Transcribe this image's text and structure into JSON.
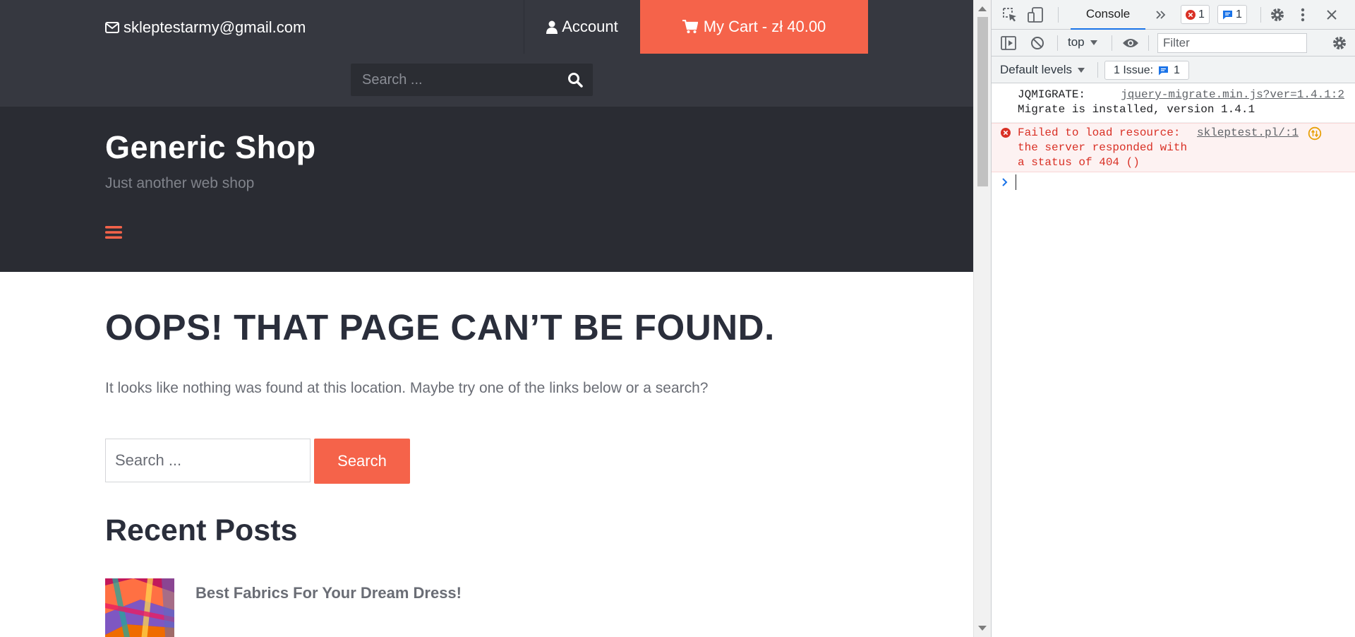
{
  "topbar": {
    "email": "skleptestarmy@gmail.com",
    "account_label": "Account",
    "cart_label": "My Cart - zł 40.00",
    "search_placeholder": "Search ..."
  },
  "header": {
    "site_title": "Generic Shop",
    "tagline": "Just another web shop"
  },
  "content": {
    "page_title": "OOPS! THAT PAGE CAN’T BE FOUND.",
    "description": "It looks like nothing was found at this location. Maybe try one of the links below or a search?",
    "search_placeholder": "Search ...",
    "search_button": "Search",
    "recent_posts_title": "Recent Posts",
    "recent_posts": [
      {
        "title": "Best Fabrics For Your Dream Dress!"
      }
    ]
  },
  "colors": {
    "accent": "#f5634a",
    "topbar_bg": "#363840",
    "header_bg": "#2a2c33",
    "devtools_blue": "#1a73e8",
    "error_red": "#d93025"
  },
  "devtools": {
    "tabs": {
      "console": "Console"
    },
    "error_count": "1",
    "message_count": "1",
    "context": "top",
    "filter_placeholder": "Filter",
    "default_levels": "Default levels",
    "issues_label": "1 Issue:",
    "issues_count": "1",
    "logs": {
      "info_prefix": "JQMIGRATE:",
      "info_source": "jquery-migrate.min.js?ver=1.4.1:2",
      "info_message": "Migrate is installed, version 1.4.1",
      "error_line1": "Failed to load resource:",
      "error_line2": "the server responded with",
      "error_line3": "a status of 404 ()",
      "error_source": "skleptest.pl/:1"
    },
    "icons": [
      "inspect-icon",
      "device-toolbar-icon",
      "more-tabs-icon",
      "settings-icon",
      "kebab-menu-icon",
      "close-icon",
      "sidebar-toggle-icon",
      "clear-console-icon",
      "eye-icon",
      "console-settings-icon"
    ]
  }
}
